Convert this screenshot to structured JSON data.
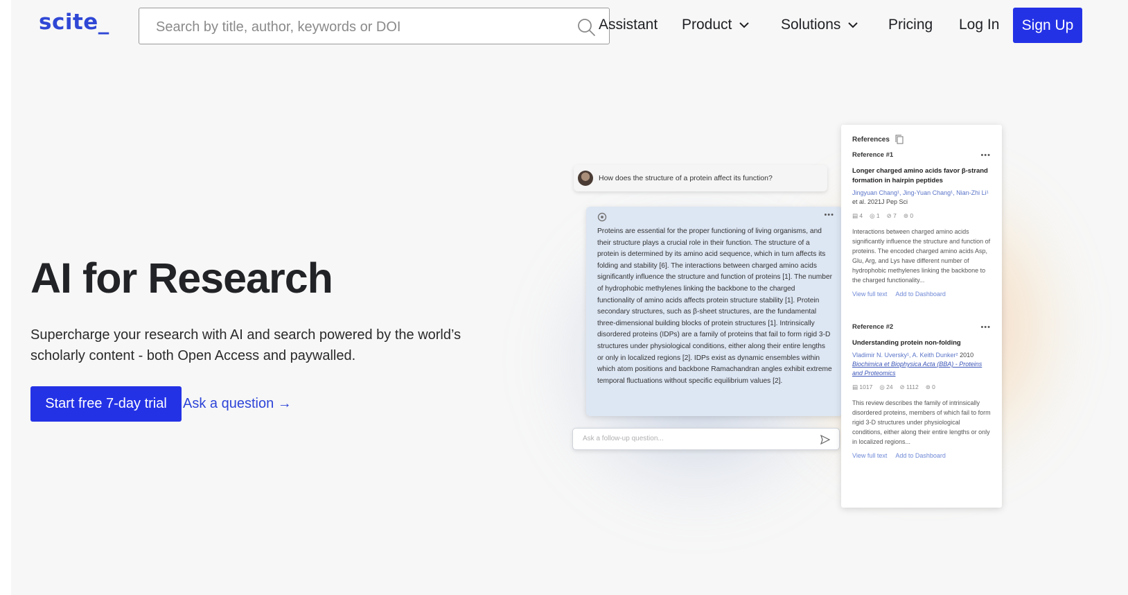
{
  "header": {
    "logo": "scite_",
    "search_placeholder": "Search by title, author, keywords or DOI",
    "nav": {
      "assistant": "Assistant",
      "product": "Product",
      "solutions": "Solutions",
      "pricing": "Pricing",
      "login": "Log In",
      "signup": "Sign Up"
    }
  },
  "hero": {
    "title": "AI for Research",
    "subtitle": "Supercharge your research with AI and search powered by the world’s scholarly content - both Open Access and paywalled.",
    "cta_primary": "Start free 7-day trial",
    "cta_secondary": "Ask a question →"
  },
  "illustration": {
    "question": "How does the structure of a protein affect its function?",
    "answer": "Proteins are essential for the proper functioning of living organisms, and their structure plays a crucial role in their function. The structure of a protein is determined by its amino acid sequence, which in turn affects its folding and stability [6]. The interactions between charged amino acids significantly influence the structure and function of proteins [1]. The number of hydrophobic methylenes linking the backbone to the charged functionality of amino acids affects protein structure stability [1]. Protein secondary structures, such as β-sheet structures, are the fundamental three-dimensional building blocks of protein structures [1]. Intrinsically disordered proteins (IDPs) are a family of proteins that fail to form rigid 3-D structures under physiological conditions, either along their entire lengths or only in localized regions [2]. IDPs exist as dynamic ensembles within which atom positions and backbone Ramachandran angles exhibit extreme temporal fluctuations without specific equilibrium values [2].",
    "more": "•••",
    "followup_placeholder": "Ask a follow-up question...",
    "references": {
      "heading": "References",
      "items": [
        {
          "label": "Reference #1",
          "title": "Longer charged amino acids favor β-strand formation in hairpin peptides",
          "authors": "Jingyuan Chang¹, Jing-Yuan Chang¹, Nian-Zhi Li¹",
          "meta": "et al. 2021J Pep Sci",
          "journal": "",
          "metrics": [
            "▤ 4",
            "◎ 1",
            "⊘ 7",
            "⊚ 0"
          ],
          "excerpt": "Interactions between charged amino acids significantly influence the structure and function of proteins. The encoded charged amino acids Asp, Glu, Arg, and Lys have different number of hydrophobic methylenes linking the backbone to the charged functionality...",
          "view": "View full text",
          "add": "Add to Dashboard"
        },
        {
          "label": "Reference #2",
          "title": "Understanding protein non-folding",
          "authors": "Vladimir N. Uversky¹, A. Keith Dunker²",
          "meta": "2010",
          "journal": "Biochimica et Biophysica Acta (BBA) - Proteins and Proteomics",
          "metrics": [
            "▤ 1017",
            "◎ 24",
            "⊘ 1112",
            "⊚ 0"
          ],
          "excerpt": "This review describes the family of intrinsically disordered proteins, members of which fail to form rigid 3-D structures under physiological conditions, either along their entire lengths or only in localized regions...",
          "view": "View full text",
          "add": "Add to Dashboard"
        }
      ]
    }
  },
  "colors": {
    "brand_blue": "#2432e6",
    "logo_blue": "#2f47d5",
    "link_blue": "#2d44d8",
    "background": "#f7f7f7"
  }
}
